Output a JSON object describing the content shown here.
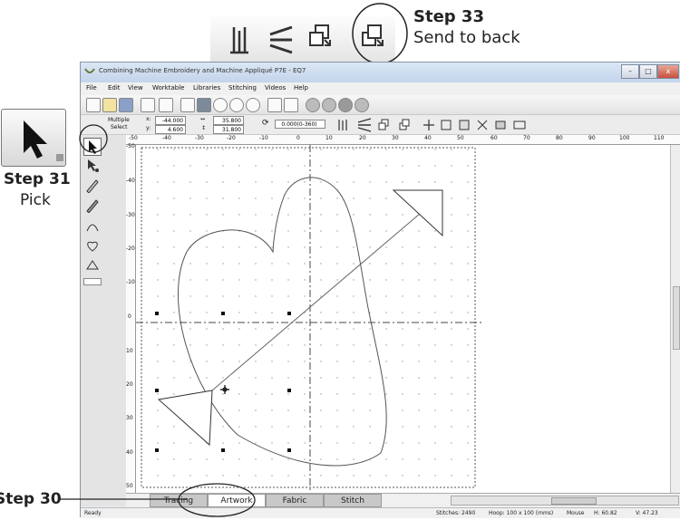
{
  "annotations": {
    "step33": {
      "number": "Step 33",
      "caption": "Send to back"
    },
    "step31": {
      "number": "Step 31",
      "caption": "Pick"
    },
    "step30": {
      "number": "Step 30"
    }
  },
  "window": {
    "title": "Combining Machine Embroidery and Machine Appliqué P7E - EQ7",
    "controls": [
      "minimize-icon",
      "maximize-icon",
      "close-icon"
    ]
  },
  "menu": [
    "File",
    "Edit",
    "View",
    "Worktable",
    "Libraries",
    "Stitching",
    "Videos",
    "Help"
  ],
  "toolbar2": {
    "mode_line1": "Multiple",
    "mode_line2": "Select",
    "x_label": "x:",
    "x_value": "-44.000",
    "y_label": "y:",
    "y_value": "4.600",
    "w_value": "35.800",
    "h_value": "31.800",
    "rotate_value": "0.000(0-360)"
  },
  "ruler_top": [
    "-50",
    "-40",
    "-30",
    "-20",
    "-10",
    "0",
    "10",
    "20",
    "30",
    "40",
    "50",
    "60",
    "70",
    "80",
    "90",
    "100",
    "110"
  ],
  "ruler_left": [
    "-50",
    "-40",
    "-30",
    "-20",
    "-10",
    "0",
    "10",
    "20",
    "30",
    "40",
    "50"
  ],
  "tabs": [
    "Tracing Image",
    "Artwork",
    "Fabric",
    "Stitch"
  ],
  "active_tab": "Artwork",
  "status": {
    "left": "Ready",
    "stitches": "Stitches: 2490",
    "hoop": "Hoop: 100 x 100 (mms)",
    "mouse": "Mouse",
    "h": "H: 60.82",
    "v": "V: 47.23"
  }
}
